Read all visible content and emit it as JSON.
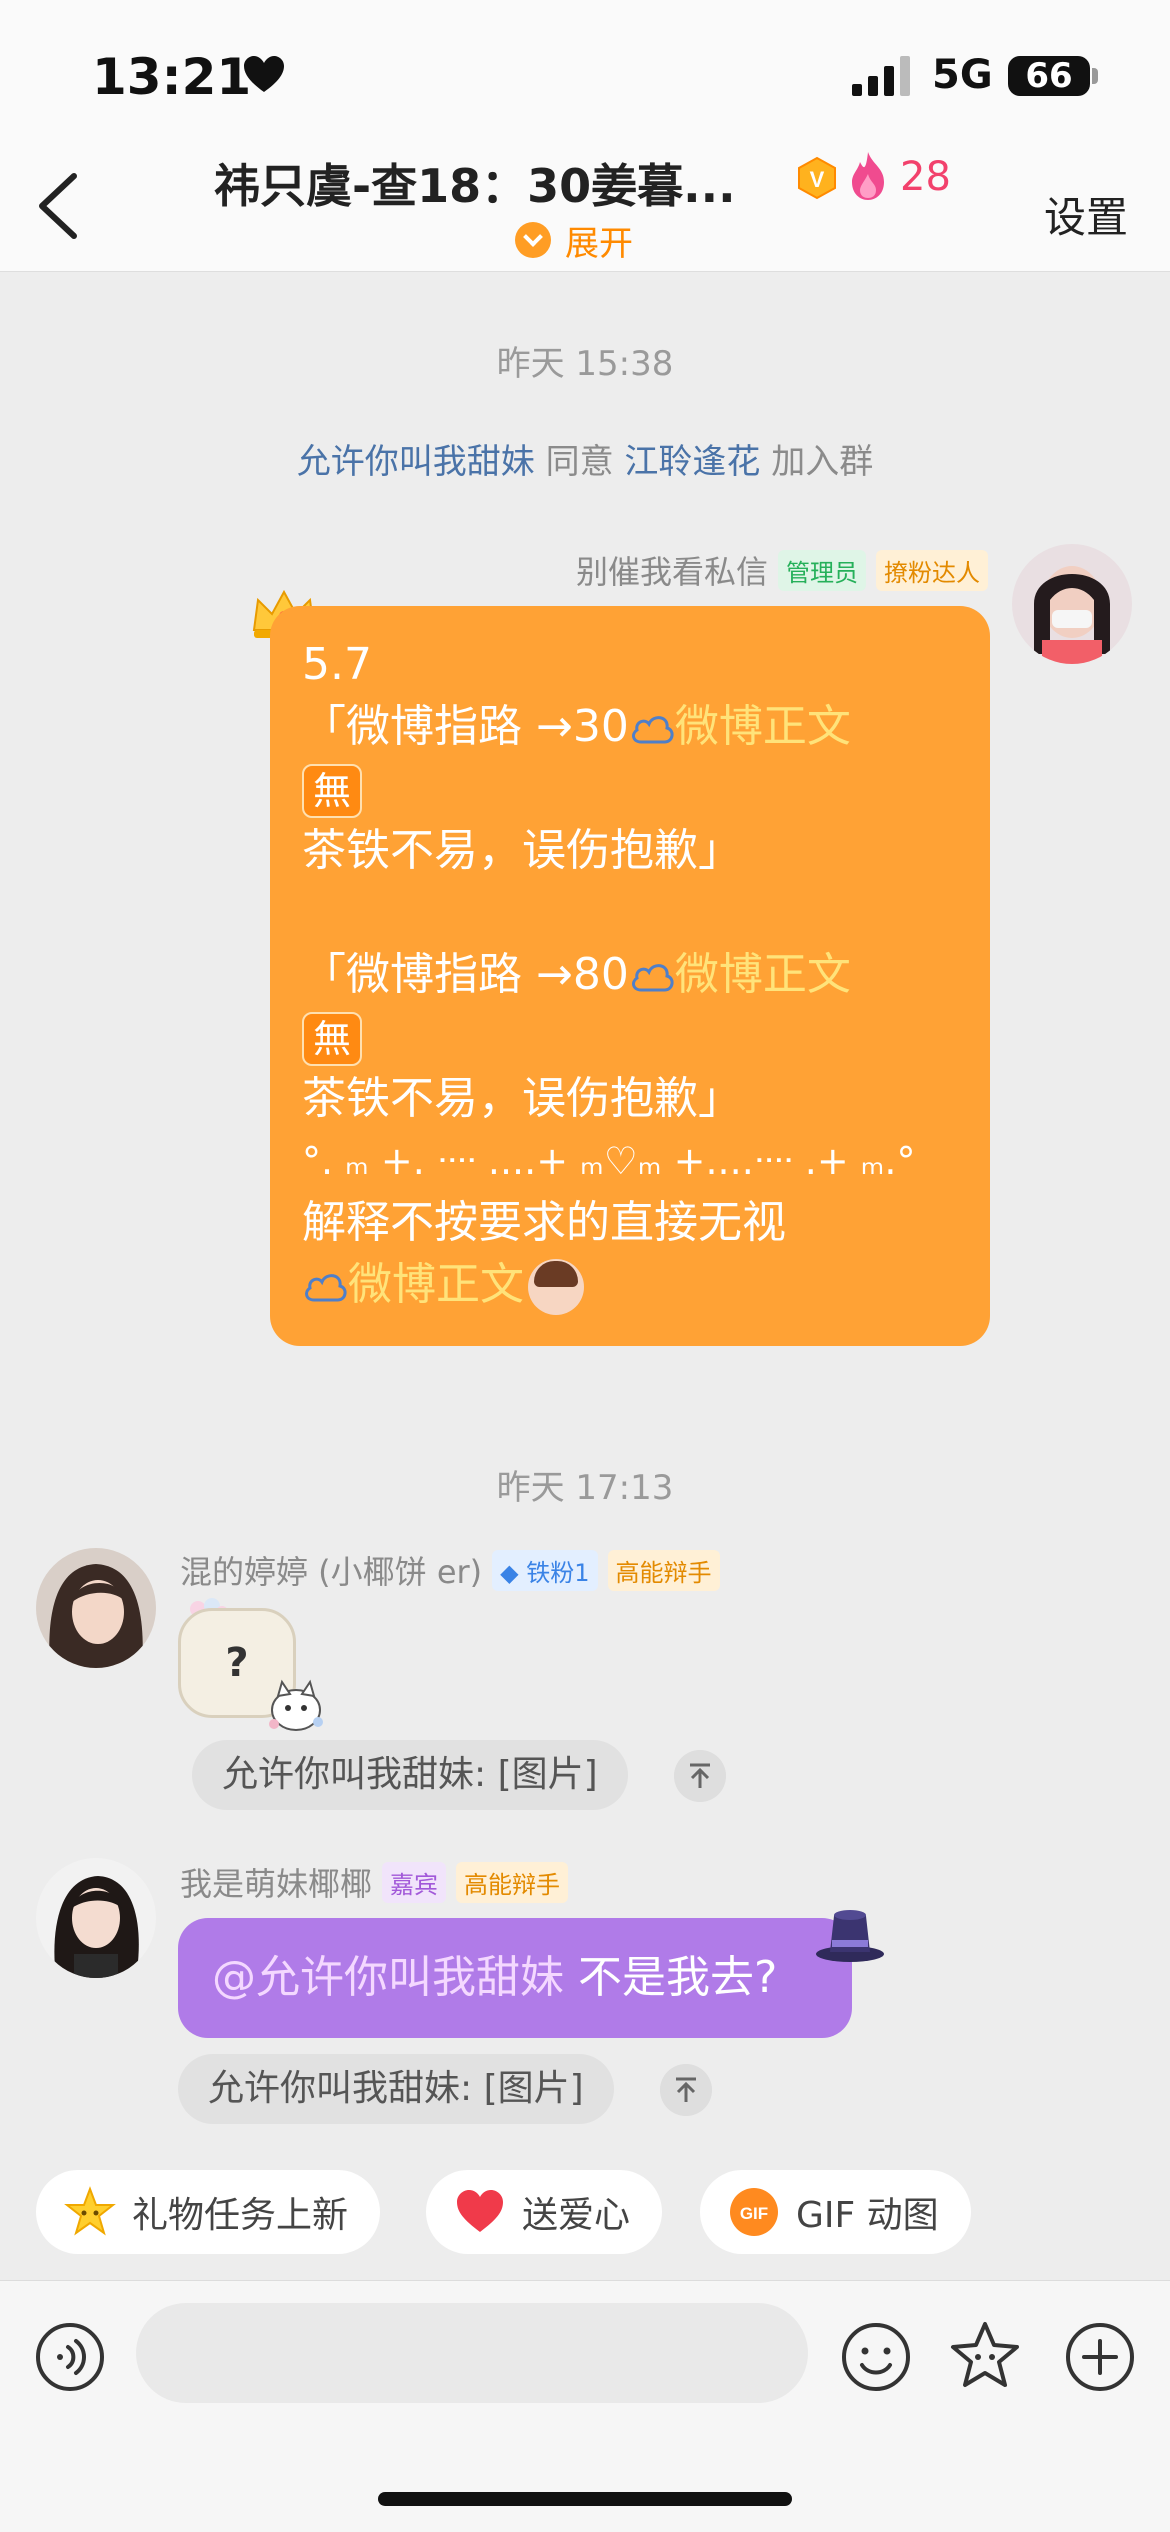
{
  "status_bar": {
    "time": "13:21",
    "network": "5G",
    "battery": "66"
  },
  "header": {
    "title": "祎只虞-查18：30姜暮...",
    "member_count": "28",
    "expand_label": "展开",
    "settings_label": "设置"
  },
  "messages": {
    "ts1": "昨天 15:38",
    "system": {
      "inviter": "允许你叫我甜妹",
      "mid": "同意",
      "invitee": "江聆逢花",
      "tail": "加入群"
    },
    "admin_msg": {
      "sender": "别催我看私信",
      "tags": [
        "管理员",
        "撩粉达人"
      ],
      "lines": {
        "l1": "5.7",
        "l2a": "「微博指路 →30",
        "l2b": "微博正文",
        "l3": "無",
        "l4": "茶铁不易，误伤抱歉」",
        "l6a": "「微博指路 →80",
        "l6b": "微博正文",
        "l7": "無",
        "l8": "茶铁不易，误伤抱歉」",
        "l9": "°. ₘ +. ᐧᐧᐧᐧ ....+ ₘ♡ₘ +....ᐧᐧᐧᐧ .+ ₘ.°",
        "l10": "解释不按要求的直接无视",
        "l11": "微博正文"
      }
    },
    "ts2": "昨天 17:13",
    "msg2": {
      "sender": "混的婷婷 (小椰饼 er)",
      "tags": [
        "铁粉1",
        "高能辩手"
      ],
      "content": "?",
      "reply": "允许你叫我甜妹: [图片]"
    },
    "msg3": {
      "sender": "我是萌妹椰椰",
      "tags": [
        "嘉宾",
        "高能辩手"
      ],
      "mention": "@允许你叫我甜妹",
      "text": " 不是我去?",
      "reply": "允许你叫我甜妹: [图片]"
    }
  },
  "quick_actions": [
    "礼物任务上新",
    "送爱心",
    "GIF 动图"
  ],
  "input": {
    "placeholder": ""
  },
  "colors": {
    "accent_orange": "#ffa235",
    "purple_bubble": "#b07be8",
    "link_blue": "#4a73a8",
    "count_pink": "#f2416c"
  }
}
